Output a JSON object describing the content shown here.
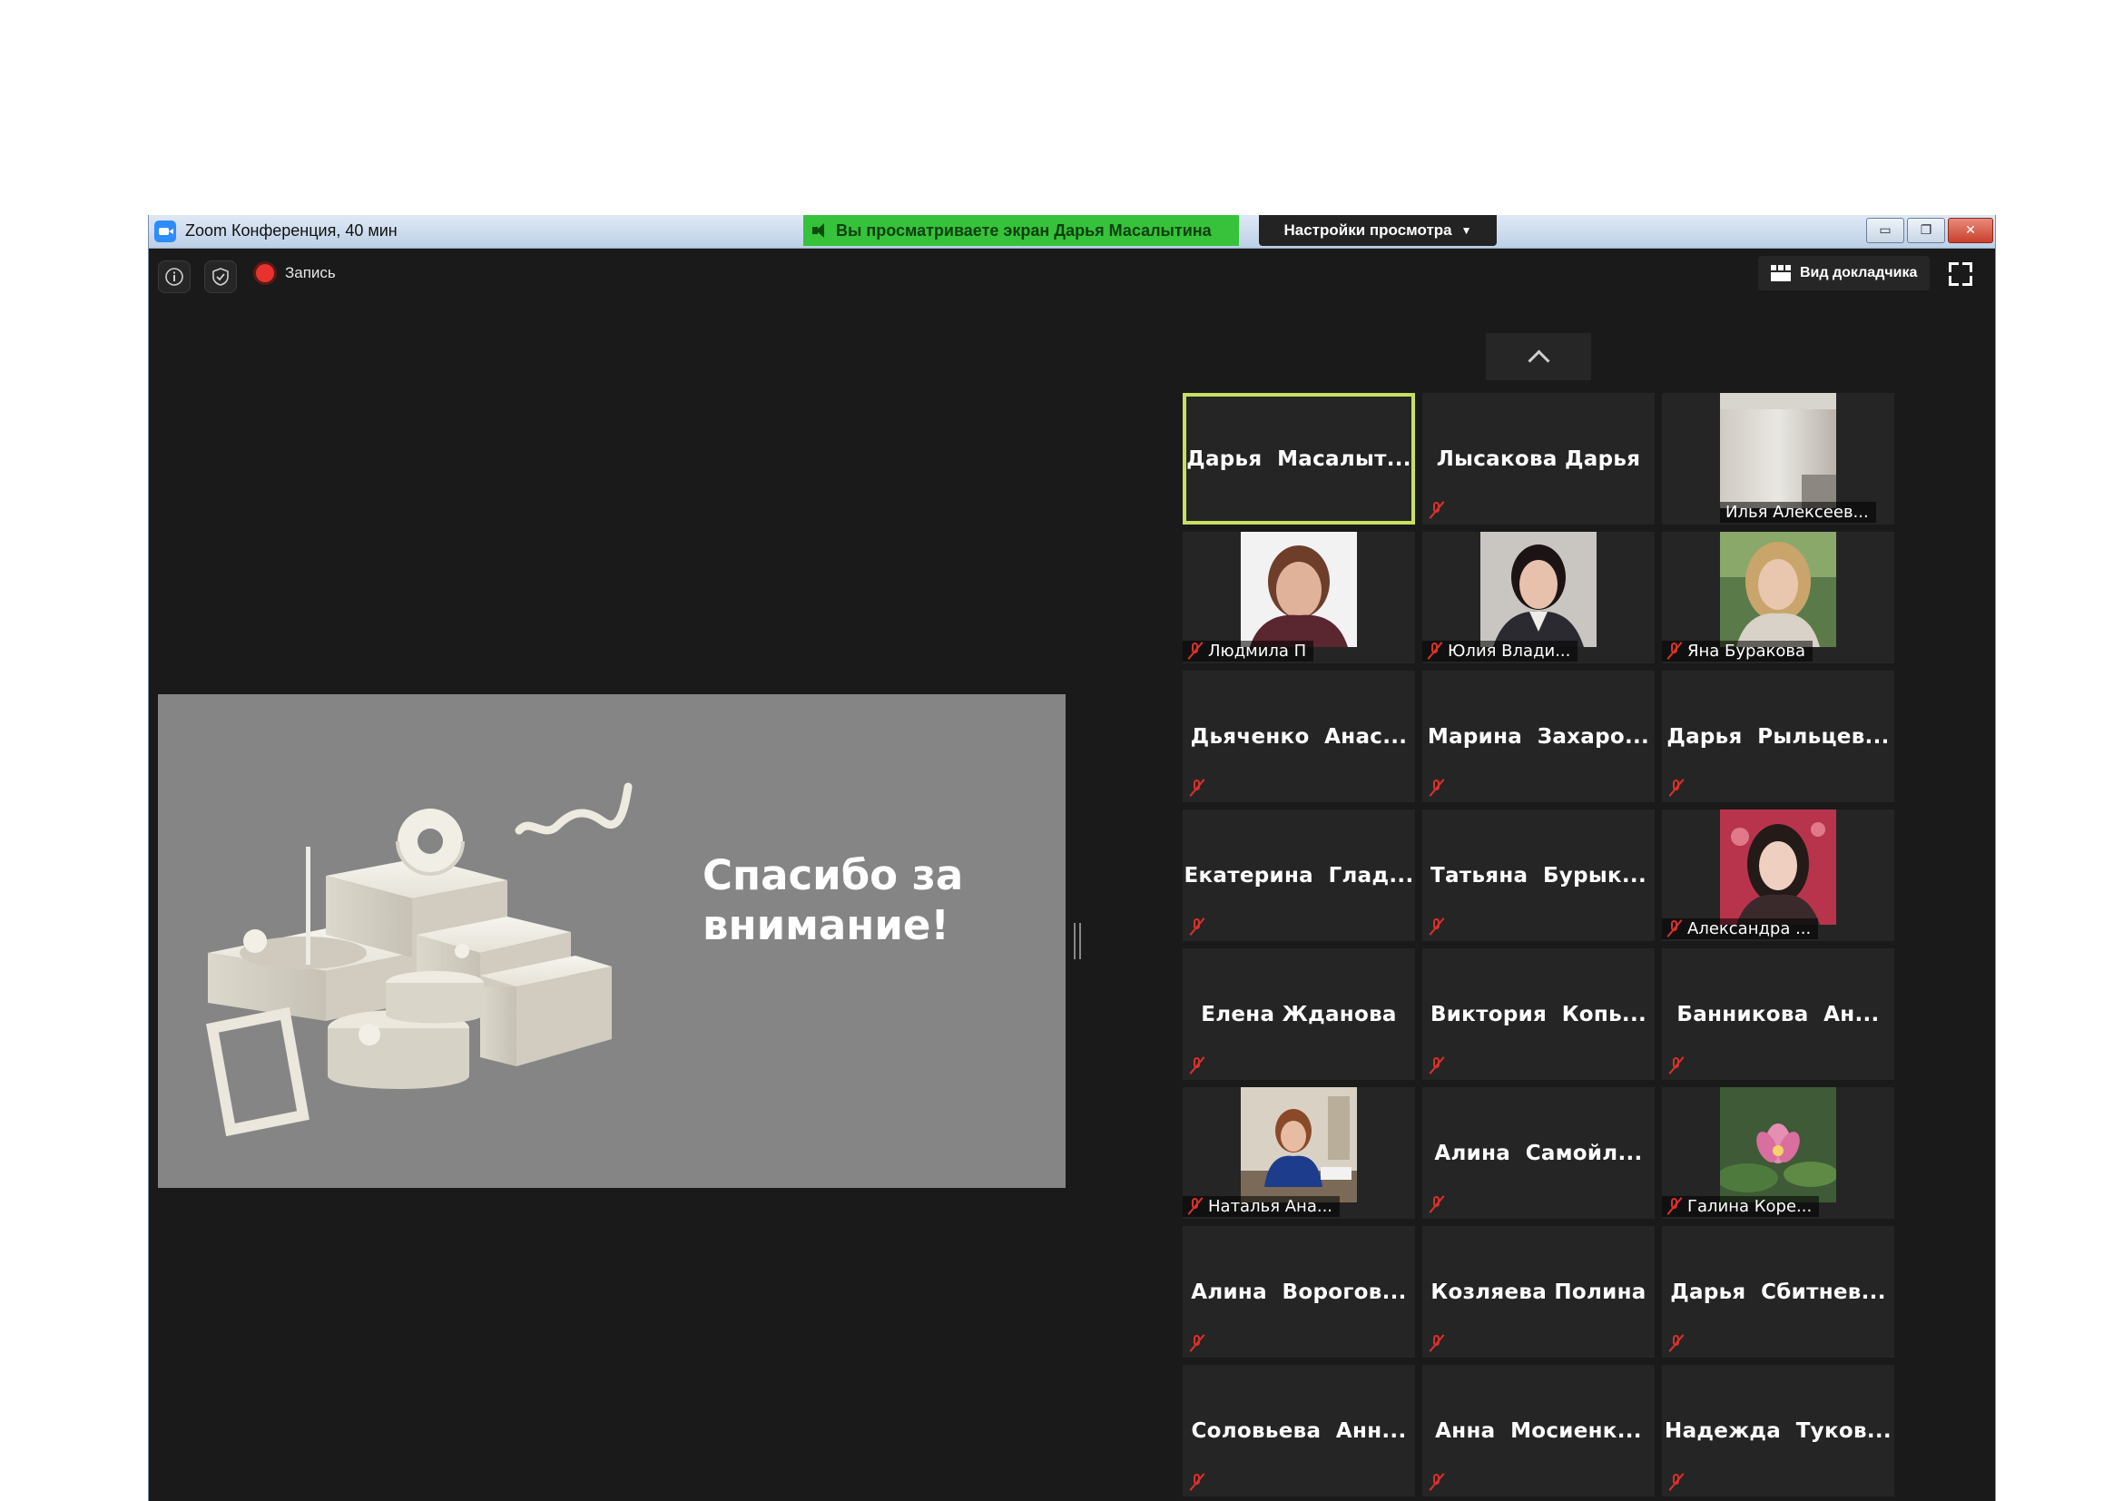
{
  "window": {
    "title": "Zoom Конференция, 40 мин",
    "share_banner": "Вы просматриваете экран Дарья Масалытина",
    "view_settings": "Настройки просмотра",
    "controls": {
      "minimize": "▭",
      "restore": "❐",
      "close": "✕"
    }
  },
  "toolbar": {
    "info_icon": "i",
    "security_icon": "✓",
    "record_label": "Запись",
    "speaker_view_label": "Вид докладчика"
  },
  "slide": {
    "heading_line1": "Спасибо за",
    "heading_line2": "внимание!"
  },
  "participants": [
    {
      "name": "Дарья  Масалыт...",
      "type": "name",
      "muted": false,
      "active": true
    },
    {
      "name": "Лысакова Дарья",
      "type": "name",
      "muted": true
    },
    {
      "name": "Илья Алексеев...",
      "type": "photo",
      "muted": false,
      "photo": "room"
    },
    {
      "name": "Людмила П",
      "type": "photo",
      "muted": true,
      "photo": "woman1"
    },
    {
      "name": "Юлия Влади...",
      "type": "photo",
      "muted": true,
      "photo": "woman2"
    },
    {
      "name": "Яна Буракова",
      "type": "photo",
      "muted": true,
      "photo": "woman3"
    },
    {
      "name": "Дьяченко  Анас...",
      "type": "name",
      "muted": true
    },
    {
      "name": "Марина  Захаро...",
      "type": "name",
      "muted": true
    },
    {
      "name": "Дарья  Рыльцев...",
      "type": "name",
      "muted": true
    },
    {
      "name": "Екатерина  Глад...",
      "type": "name",
      "muted": true
    },
    {
      "name": "Татьяна  Бурык...",
      "type": "name",
      "muted": true
    },
    {
      "name": "Александра ...",
      "type": "photo",
      "muted": true,
      "photo": "woman4"
    },
    {
      "name": "Елена Жданова",
      "type": "name",
      "muted": true
    },
    {
      "name": "Виктория  Копь...",
      "type": "name",
      "muted": true
    },
    {
      "name": "Банникова  Ан...",
      "type": "name",
      "muted": true
    },
    {
      "name": "Наталья Ана...",
      "type": "photo",
      "muted": true,
      "photo": "office"
    },
    {
      "name": "Алина  Самойл...",
      "type": "name",
      "muted": true
    },
    {
      "name": "Галина Коре...",
      "type": "photo",
      "muted": true,
      "photo": "flower"
    },
    {
      "name": "Алина  Ворогов...",
      "type": "name",
      "muted": true
    },
    {
      "name": "Козляева Полина",
      "type": "name",
      "muted": true
    },
    {
      "name": "Дарья  Сбитнев...",
      "type": "name",
      "muted": true
    },
    {
      "name": "Соловьева  Анн...",
      "type": "name",
      "muted": true
    },
    {
      "name": "Анна  Мосиенк...",
      "type": "name",
      "muted": true
    },
    {
      "name": "Надежда  Туков...",
      "type": "name",
      "muted": true
    }
  ],
  "colors": {
    "active_speaker_border": "#c7e060",
    "share_banner_bg": "#36c23b",
    "muted_icon": "#d9312b",
    "window_bg": "#1a1a1a",
    "slide_bg": "#858585"
  }
}
